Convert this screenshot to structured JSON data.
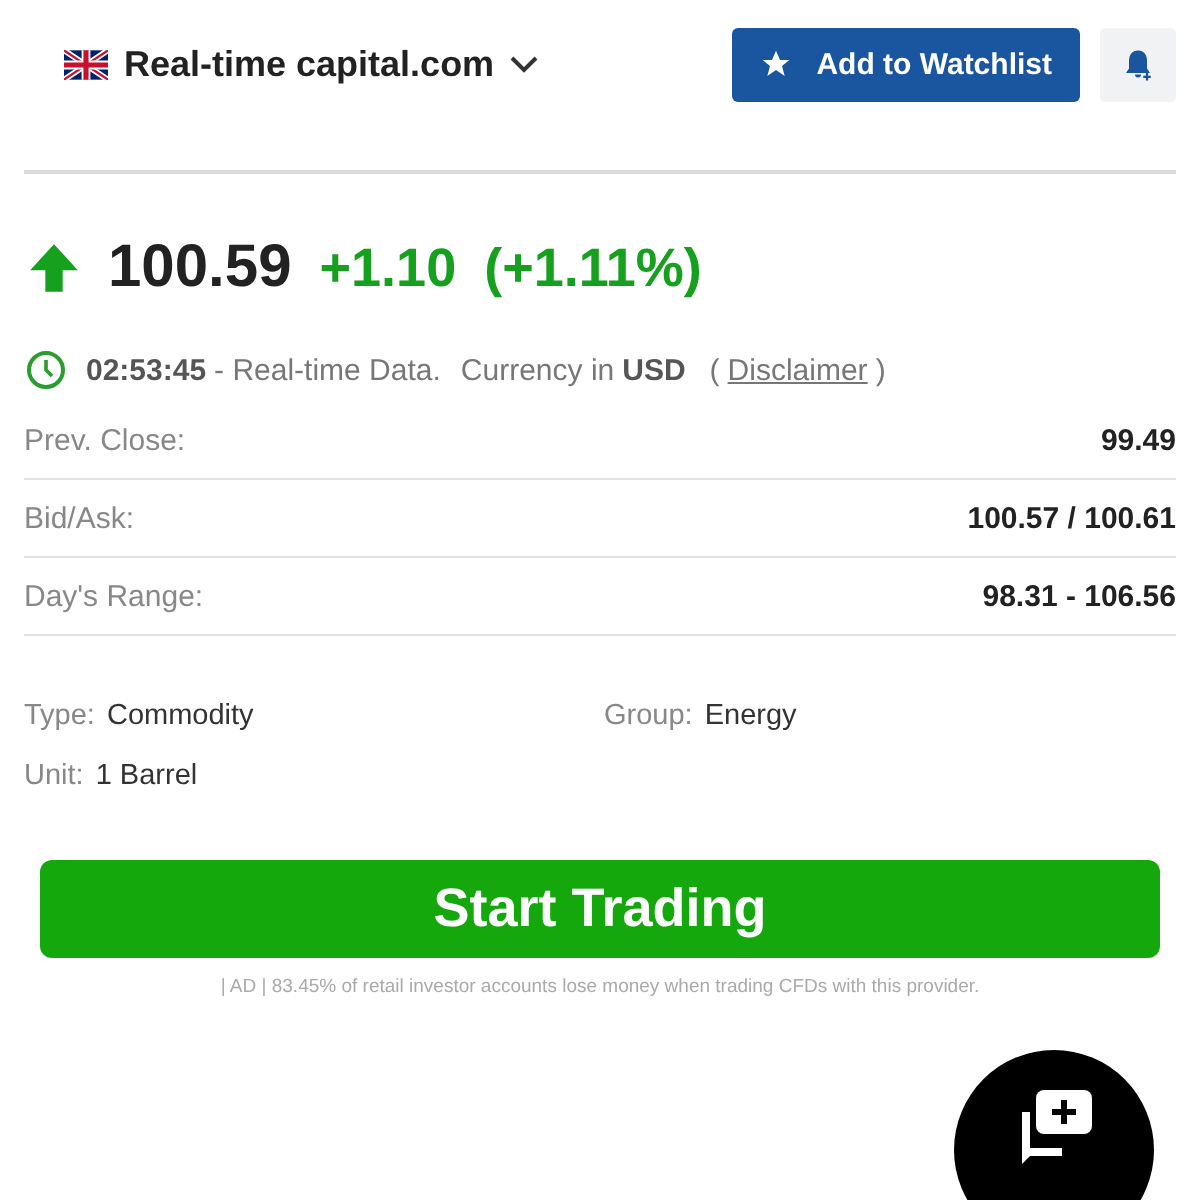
{
  "header": {
    "source": "Real-time capital.com",
    "watchlist_button": "Add to Watchlist"
  },
  "quote": {
    "rising": true,
    "price": "100.59",
    "change": "+1.10",
    "change_percent": "(+1.11%)"
  },
  "timestamp": {
    "time": "02:53:45",
    "text": "- Real-time Data.",
    "currency_label": "Currency in",
    "currency": "USD",
    "open_paren": "(",
    "disclaimer": "Disclaimer",
    "close_paren": ")"
  },
  "stats": [
    {
      "label": "Prev. Close:",
      "value": "99.49"
    },
    {
      "label": "Bid/Ask:",
      "value": "100.57 / 100.61"
    },
    {
      "label": "Day's Range:",
      "value": "98.31 - 106.56"
    }
  ],
  "info": [
    {
      "label": "Type:",
      "value": "Commodity"
    },
    {
      "label": "Group:",
      "value": "Energy"
    },
    {
      "label": "Unit:",
      "value": "1 Barrel"
    }
  ],
  "cta": {
    "label": "Start Trading",
    "note": "| AD | 83.45% of retail investor accounts lose money when trading CFDs with this provider."
  }
}
